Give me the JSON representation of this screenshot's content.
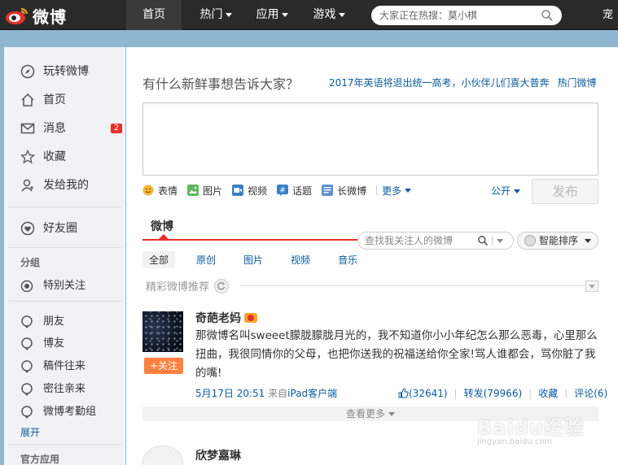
{
  "topbar": {
    "logo_text": "微博",
    "nav": {
      "home": "首页",
      "hot": "热门",
      "apps": "应用",
      "games": "游戏"
    },
    "search_placeholder": "大家正在热搜：莫小棋",
    "user": "宠"
  },
  "sidebar": {
    "items": [
      {
        "label": "玩转微博",
        "icon": "compass-icon"
      },
      {
        "label": "首页",
        "icon": "home-icon"
      },
      {
        "label": "消息",
        "icon": "mail-icon",
        "badge": "2"
      },
      {
        "label": "收藏",
        "icon": "star-icon"
      },
      {
        "label": "发给我的",
        "icon": "user-icon"
      }
    ],
    "friends": "好友圈",
    "group_heading": "分组",
    "special": "特别关注",
    "groups": [
      "朋友",
      "博友",
      "稿件往来",
      "密往亲来",
      "微博考勤组"
    ],
    "expand": "展开",
    "official_apps": "官方应用"
  },
  "composer": {
    "prompt": "有什么新鲜事想告诉大家？",
    "hot_topic": "2017年英语将退出统一高考，小伙伴儿们喜大普奔",
    "hot_link": "热门微博",
    "tools": [
      "表情",
      "图片",
      "视频",
      "话题",
      "长微博"
    ],
    "more": "更多",
    "visibility": "公开",
    "publish": "发布"
  },
  "feed": {
    "tab": "微博",
    "search_placeholder": "查找我关注人的微博",
    "sort": "智能排序",
    "filters": [
      "全部",
      "原创",
      "图片",
      "视频",
      "音乐"
    ],
    "recommend": "精彩微博推荐"
  },
  "post": {
    "author": "奇葩老妈",
    "follow": "+关注",
    "text": "那微博名叫sweeet朦胧朦胧月光的，我不知道你小小年纪怎么那么恶毒，心里那么扭曲，我很同情你的父母，也把你送我的祝福送给你全家!骂人谁都会，骂你脏了我的嘴!",
    "time": "5月17日 20:51",
    "from_prefix": "来自",
    "source": "iPad客户端",
    "likes": "(32641)",
    "repost": "转发(79966)",
    "favorite": "收藏",
    "comment": "评论(6)",
    "view_more": "查看更多"
  },
  "post2": {
    "author": "欣梦嘉琳"
  },
  "watermark": {
    "main": "Baidu经验",
    "sub": "jingyan.baidu.com"
  },
  "colors": {
    "accent_red": "#e5302d",
    "link_blue": "#0a5a9c",
    "follow_orange": "#ff8140"
  }
}
